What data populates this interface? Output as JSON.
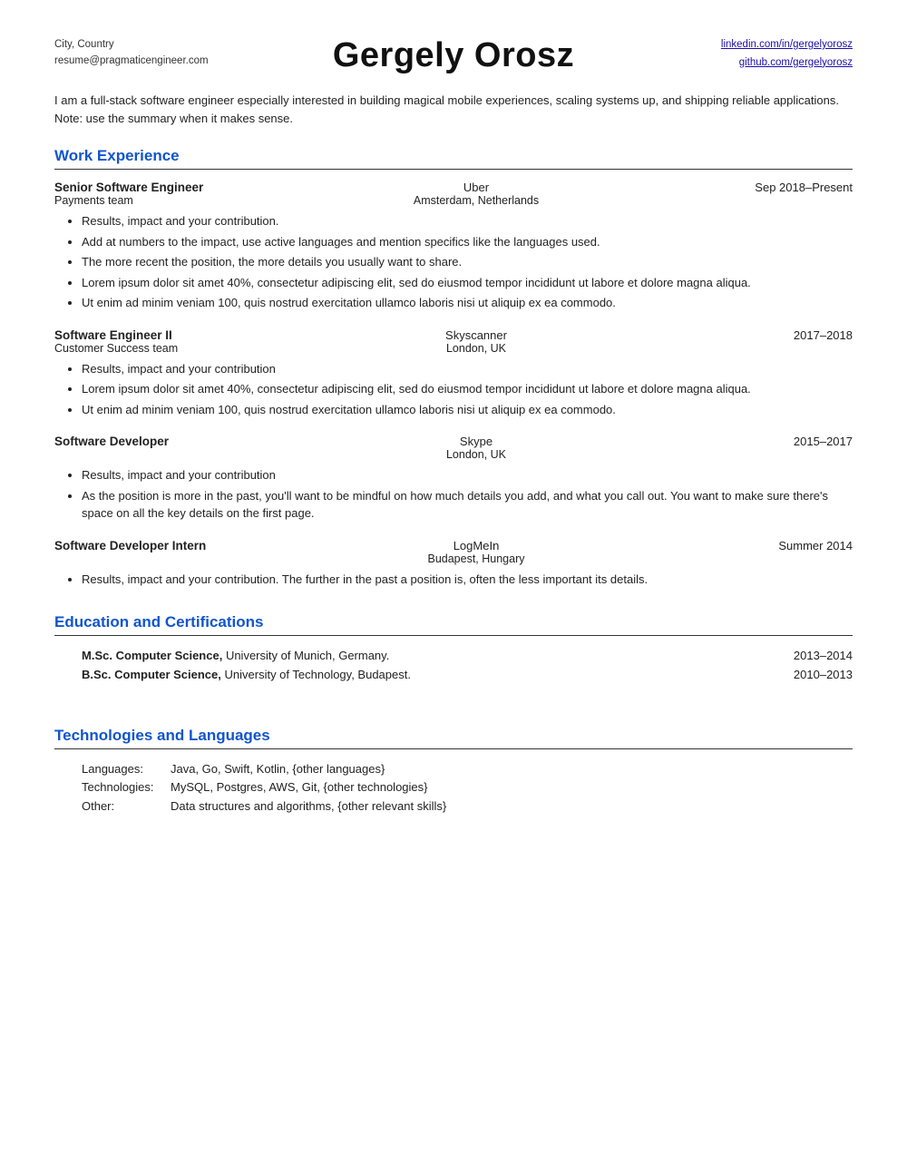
{
  "header": {
    "left": {
      "location": "City, Country",
      "email": "resume@pragmaticengineer.com"
    },
    "name": "Gergely Orosz",
    "right": {
      "linkedin": "linkedin.com/in/gergelyorosz",
      "github": "github.com/gergelyorosz"
    }
  },
  "summary": "I am a full-stack software engineer especially interested in building magical mobile experiences, scaling systems up, and shipping reliable applications. Note: use the summary when it makes sense.",
  "work_experience": {
    "section_title": "Work Experience",
    "jobs": [
      {
        "title": "Senior Software Engineer",
        "team": "Payments team",
        "company": "Uber",
        "location": "Amsterdam, Netherlands",
        "period": "Sep 2018–Present",
        "bullets": [
          "Results, impact and your contribution.",
          "Add at numbers to the impact, use active languages and mention specifics like the languages used.",
          "The more recent the position, the more details you usually want to share.",
          "Lorem ipsum dolor sit amet 40%, consectetur adipiscing elit, sed do eiusmod tempor incididunt ut labore et dolore magna aliqua.",
          "Ut enim ad minim veniam 100, quis nostrud exercitation ullamco laboris nisi ut aliquip ex ea commodo."
        ]
      },
      {
        "title": "Software Engineer II",
        "team": "Customer Success team",
        "company": "Skyscanner",
        "location": "London, UK",
        "period": "2017–2018",
        "bullets": [
          "Results, impact and your contribution",
          "Lorem ipsum dolor sit amet 40%, consectetur adipiscing elit, sed do eiusmod tempor incididunt ut labore et dolore magna aliqua.",
          "Ut enim ad minim veniam 100, quis nostrud exercitation ullamco laboris nisi ut aliquip ex ea commodo."
        ]
      },
      {
        "title": "Software Developer",
        "team": "",
        "company": "Skype",
        "location": "London, UK",
        "period": "2015–2017",
        "bullets": [
          "Results, impact and your contribution",
          "As the position is more in the past, you'll want to be mindful on how much details you add, and what you call out. You want to make sure there's space on all the key details on the first page."
        ]
      },
      {
        "title": "Software Developer Intern",
        "team": "",
        "company": "LogMeIn",
        "location": "Budapest, Hungary",
        "period": "Summer 2014",
        "bullets": [
          "Results, impact and your contribution. The further in the past a position is, often the less important its details."
        ]
      }
    ]
  },
  "education": {
    "section_title": "Education and Certifications",
    "items": [
      {
        "text_bold": "M.Sc. Computer Science,",
        "text_rest": " University of Munich, Germany.",
        "year": "2013–2014"
      },
      {
        "text_bold": "B.Sc. Computer Science,",
        "text_rest": " University of Technology, Budapest.",
        "year": "2010–2013"
      }
    ]
  },
  "technologies": {
    "section_title": "Technologies and Languages",
    "items": [
      {
        "label": "Languages:",
        "value": "Java, Go, Swift, Kotlin, {other languages}"
      },
      {
        "label": "Technologies:",
        "value": "MySQL, Postgres, AWS, Git, {other technologies}"
      },
      {
        "label": "Other:",
        "value": "Data structures and algorithms, {other relevant skills}"
      }
    ]
  }
}
